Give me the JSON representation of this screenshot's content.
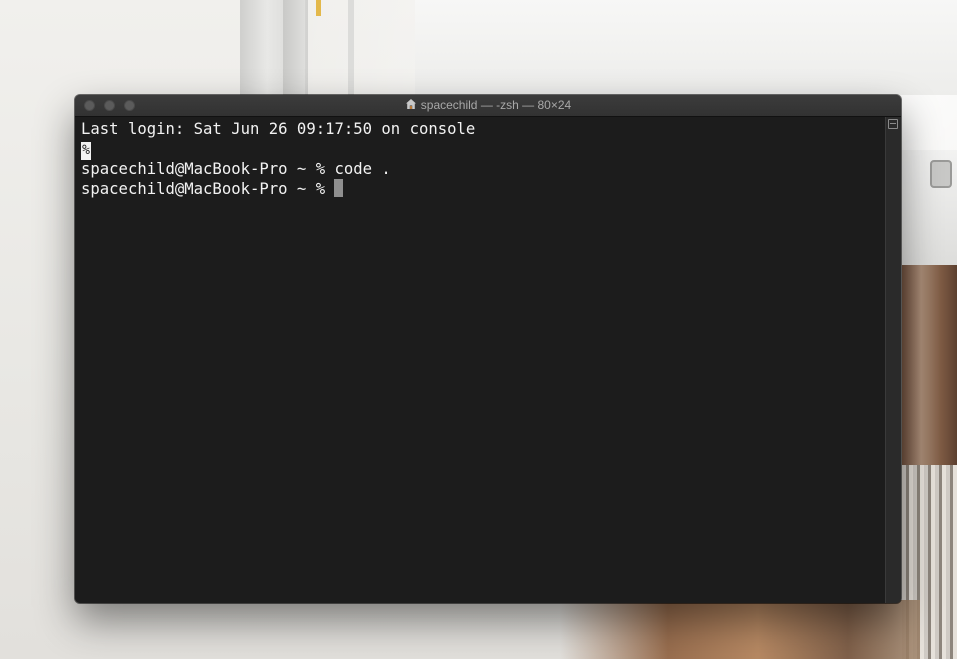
{
  "window": {
    "title": "spacechild — -zsh — 80×24",
    "title_icon": "home-icon"
  },
  "terminal": {
    "lines": [
      "Last login: Sat Jun 26 09:17:50 on console",
      "%",
      "spacechild@MacBook-Pro ~ % code .",
      "spacechild@MacBook-Pro ~ % "
    ],
    "marker_glyph": "%",
    "right_edge_glyph": "]"
  },
  "colors": {
    "terminal_background": "#1c1c1c",
    "terminal_text": "#f2f2f2",
    "cursor": "#8f8f8f",
    "titlebar": "#363636"
  }
}
